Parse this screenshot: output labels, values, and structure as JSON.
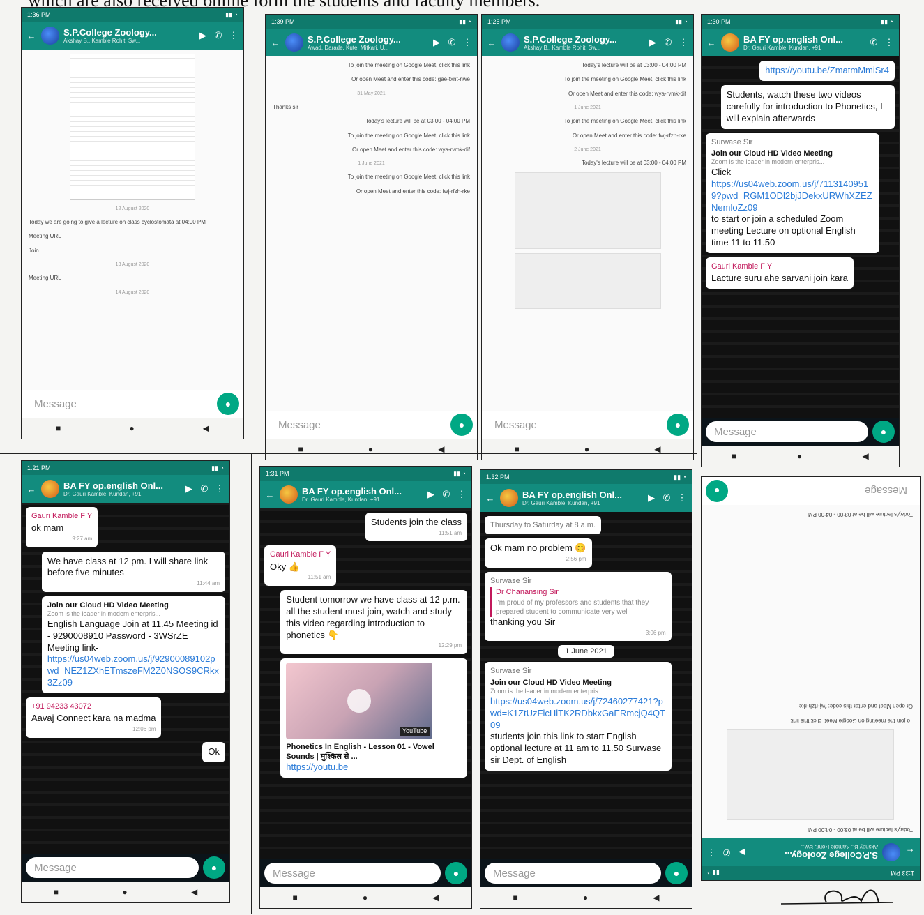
{
  "caption": "which are also received online form the students and faculty members.",
  "common": {
    "message_placeholder": "Message"
  },
  "phones": [
    {
      "status_time": "1:36 PM",
      "title": "S.P.College Zoology...",
      "subtitle": "Akshay B., Kamble Rohit, Sw...",
      "messages": [
        {
          "type": "day",
          "text": "12 August 2020"
        },
        {
          "type": "text",
          "text": "Today we are going to give a lecture on class cyclostomata at 04:00 PM"
        },
        {
          "type": "text",
          "text": "Meeting URL"
        },
        {
          "type": "text",
          "text": "Join"
        },
        {
          "type": "day",
          "text": "13 August 2020"
        },
        {
          "type": "text",
          "text": "Meeting URL"
        },
        {
          "type": "day",
          "text": "14 August 2020"
        }
      ]
    },
    {
      "status_time": "1:39 PM",
      "title": "S.P.College Zoology...",
      "subtitle": "Awad, Darade, Kute, Mitkari, U...",
      "messages": [
        {
          "type": "text",
          "text": "To join the meeting on Google Meet, click this link"
        },
        {
          "type": "text",
          "text": "Or open Meet and enter this code: gae-fxnt-nwe"
        },
        {
          "type": "day",
          "text": "31 May 2021"
        },
        {
          "type": "text",
          "text": "Thanks sir"
        },
        {
          "type": "text",
          "text": "Today's lecture will be at 03:00 - 04:00 PM"
        },
        {
          "type": "text",
          "text": "To join the meeting on Google Meet, click this link"
        },
        {
          "type": "text",
          "text": "Or open Meet and enter this code: wya-rvmk-dif"
        },
        {
          "type": "day",
          "text": "1 June 2021"
        },
        {
          "type": "text",
          "text": "To join the meeting on Google Meet, click this link"
        },
        {
          "type": "text",
          "text": "Or open Meet and enter this code: fwj-rfzh-rke"
        }
      ]
    },
    {
      "status_time": "1:25 PM",
      "title": "S.P.College Zoology...",
      "subtitle": "Akshay B., Kamble Rohit, Sw...",
      "messages": [
        {
          "type": "text",
          "text": "Today's lecture will be at 03:00 - 04:00 PM"
        },
        {
          "type": "text",
          "text": "To join the meeting on Google Meet, click this link"
        },
        {
          "type": "text",
          "text": "Or open Meet and enter this code: wya-rvmk-dif"
        },
        {
          "type": "day",
          "text": "1 June 2021"
        },
        {
          "type": "text",
          "text": "To join the meeting on Google Meet, click this link"
        },
        {
          "type": "text",
          "text": "Or open Meet and enter this code: fwj-rfzh-rke"
        },
        {
          "type": "day",
          "text": "2 June 2021"
        },
        {
          "type": "text",
          "text": "Today's lecture will be at 03:00 - 04:00 PM"
        }
      ]
    },
    {
      "status_time": "1:30 PM",
      "title": "BA FY op.english Onl...",
      "subtitle": "Dr. Gauri Kamble, Kundan, +91",
      "messages": [
        {
          "type": "link",
          "text": "https://youtu.be/ZmatmMmiSr4"
        },
        {
          "type": "text",
          "text": "Students, watch these two videos carefully for introduction to Phonetics, I will explain afterwards"
        },
        {
          "type": "zoom",
          "sender": "Surwase Sir",
          "heading": "Join our Cloud HD Video Meeting",
          "desc": "Zoom is the leader in modern enterpris...",
          "body": "Click",
          "link": "https://us04web.zoom.us/j/71131409519?pwd=RGM1ODl2bjJDekxURWhXZEZNemloZz09",
          "after": "to start or join a scheduled Zoom meeting Lecture on optional English time 11 to 11.50"
        },
        {
          "type": "text",
          "sender": "Gauri Kamble F Y",
          "text": "Lacture suru ahe sarvani join kara"
        }
      ]
    },
    {
      "status_time": "1:21 PM",
      "title": "BA FY op.english Onl...",
      "subtitle": "Dr. Gauri Kamble, Kundan, +91",
      "messages": [
        {
          "type": "text",
          "sender": "Gauri Kamble F Y",
          "text": "ok mam",
          "time": "9:27 am"
        },
        {
          "type": "text",
          "text": "We have class at 12 pm. I will share link before five minutes",
          "time": "11:44 am"
        },
        {
          "type": "zoom",
          "heading": "Join our Cloud HD Video Meeting",
          "desc": "Zoom is the leader in modern enterpris...",
          "body": "English Language Join at 11.45 Meeting id - 9290008910 Password - 3WSrZE Meeting link-",
          "link": "https://us04web.zoom.us/j/92900089102pwd=NEZ1ZXhETmszeFM2Z0NSOS9CRkx3Zz09",
          "after": ""
        },
        {
          "type": "text",
          "sender": "+91 94233 43072",
          "text": "Aavaj Connect kara na madma",
          "time": "12:06 pm"
        },
        {
          "type": "text",
          "text": "Ok"
        }
      ]
    },
    {
      "status_time": "1:31 PM",
      "title": "BA FY op.english Onl...",
      "subtitle": "Dr. Gauri Kamble, Kundan, +91",
      "messages": [
        {
          "type": "text",
          "text": "Students join the class",
          "time": "11:51 am"
        },
        {
          "type": "text",
          "sender": "Gauri Kamble F Y",
          "text": "Oky 👍",
          "time": "11:51 am"
        },
        {
          "type": "text",
          "text": "Student tomorrow we have class at 12 p.m. all the student must join, watch and study this video regarding introduction to phonetics 👇",
          "time": "12:29 pm"
        },
        {
          "type": "youtube",
          "brand": "YouTube",
          "title": "Phonetics In English - Lesson 01 - Vowel Sounds | मुश्किल से ...",
          "link": "https://youtu.be"
        }
      ]
    },
    {
      "status_time": "1:32 PM",
      "title": "BA FY op.english Onl...",
      "subtitle": "Dr. Gauri Kamble, Kundan, +91",
      "messages": [
        {
          "type": "text",
          "text": "Thursday to Saturday at 8 a.m."
        },
        {
          "type": "text",
          "text": "Ok mam no problem 😊",
          "time": "2:56 pm"
        },
        {
          "type": "text",
          "sender": "Surwase Sir",
          "quote": "Dr Chanansing Sir",
          "quote_text": "I'm proud of my professors and students that they prepared student to communicate very well",
          "text": "thanking you Sir",
          "time": "3:06 pm"
        },
        {
          "type": "day",
          "text": "1 June 2021"
        },
        {
          "type": "zoom",
          "sender": "Surwase Sir",
          "heading": "Join our Cloud HD Video Meeting",
          "desc": "Zoom is the leader in modern enterpris...",
          "body": "",
          "link": "https://us04web.zoom.us/j/72460277421?pwd=K1ZtUzFlcHlTK2RDbkxGaERmcjQ4QT09",
          "after": "students join this link to start English optional lecture at 11 am to 11.50 Surwase sir Dept. of English"
        }
      ]
    },
    {
      "status_time": "1:33 PM",
      "title": "S.P.College Zoology...",
      "subtitle": "Akshay B., Kamble Rohit, Sw...",
      "messages": [
        {
          "type": "text",
          "text": "Today's lecture will be at 03:00 - 04:00 PM"
        },
        {
          "type": "image"
        },
        {
          "type": "text",
          "text": "To join the meeting on Google Meet, click this link"
        },
        {
          "type": "text",
          "text": "Or open Meet and enter this code: fwj-rfzh-rke"
        },
        {
          "type": "text",
          "text": "Today's lecture will be at 03:00 - 04:00 PM"
        }
      ]
    }
  ]
}
